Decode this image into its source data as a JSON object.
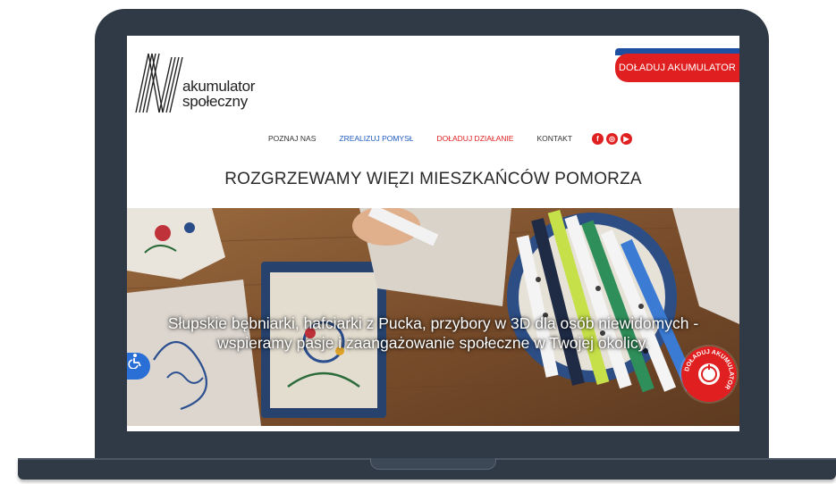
{
  "site": {
    "logo_line1": "akumulator",
    "logo_line2": "społeczny"
  },
  "header": {
    "cta_label": "DOŁADUJ AKUMULATOR"
  },
  "nav": {
    "items": [
      {
        "label": "POZNAJ NAS"
      },
      {
        "label": "ZREALIZUJ POMYSŁ"
      },
      {
        "label": "DOŁADUJ DZIAŁANIE"
      },
      {
        "label": "KONTAKT"
      }
    ],
    "social": [
      {
        "icon": "facebook-icon",
        "glyph": "f"
      },
      {
        "icon": "instagram-icon",
        "glyph": "◎"
      },
      {
        "icon": "youtube-icon",
        "glyph": "▶"
      }
    ]
  },
  "main": {
    "headline": "ROZGRZEWAMY WIĘZI MIESZKAŃCÓW POMORZA"
  },
  "hero": {
    "caption_line1": "Słupskie bębniarki, hafciarki z Pucka, przybory w 3D dla osób niewidomych -",
    "caption_line2": "wspieramy pasje i zaangażowanie społeczne w Twojej okolicy.",
    "badge_text": "DOŁADUJ AKUMULATOR"
  },
  "colors": {
    "brand_red": "#e02020",
    "brand_blue": "#1f4fa0",
    "nav_blue": "#1f5bbf",
    "laptop_frame": "#2f3a46"
  }
}
